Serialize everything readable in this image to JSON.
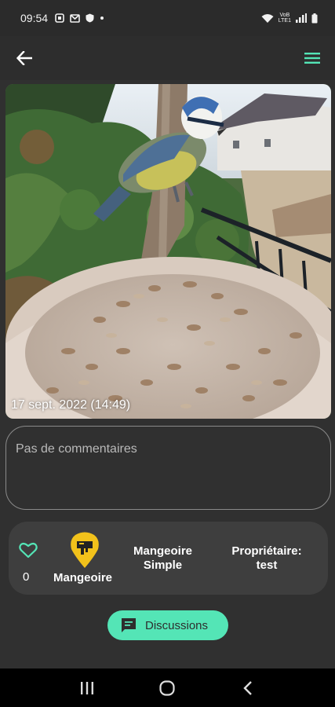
{
  "status_bar": {
    "time": "09:54",
    "wifi_sub": "VoB",
    "lte_sub": "LTE1"
  },
  "app_bar": {
    "back_icon": "arrow-left-icon",
    "menu_icon": "hamburger-menu-icon",
    "accent": "#54e5b6"
  },
  "photo": {
    "caption": "17 sept. 2022 (14:49)"
  },
  "comments": {
    "placeholder": "Pas de commentaires"
  },
  "info": {
    "likes": "0",
    "feeder_name": "Mangeoire",
    "type_line1": "Mangeoire",
    "type_line2": "Simple",
    "owner_line1": "Propriétaire:",
    "owner_line2": "test",
    "marker_color": "#f2c21b"
  },
  "discussions_button": {
    "label": "Discussions",
    "icon": "chat-icon",
    "color": "#54e5b6"
  },
  "nav": {
    "recents_icon": "recents-icon",
    "home_icon": "home-circle-icon",
    "back_icon": "chevron-left-icon"
  }
}
